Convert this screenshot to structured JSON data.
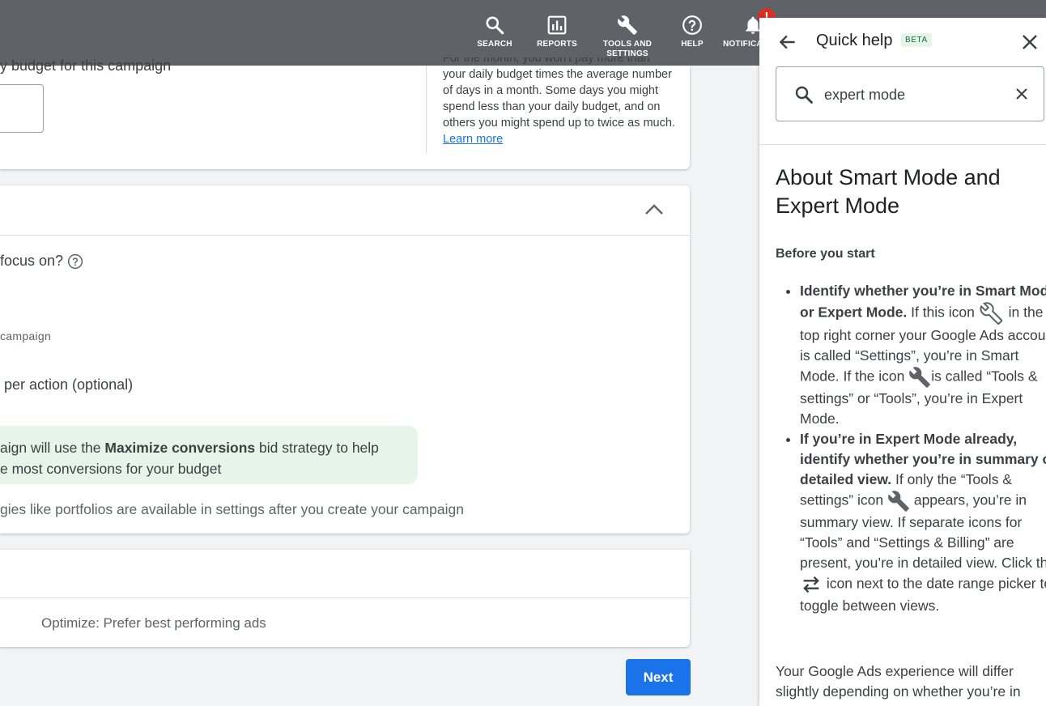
{
  "topbar": {
    "buttons": [
      {
        "label": "SEARCH",
        "icon": "search-icon"
      },
      {
        "label": "REPORTS",
        "icon": "reports-icon"
      },
      {
        "label": "TOOLS AND SETTINGS",
        "label_line1": "TOOLS AND",
        "label_line2": "SETTINGS",
        "icon": "wrench-icon"
      },
      {
        "label": "HELP",
        "icon": "help-icon"
      },
      {
        "label": "NOTIFICA",
        "icon": "bell-icon",
        "badge": "!"
      }
    ]
  },
  "budget": {
    "label": "y budget for this campaign",
    "help_line0": "For the month, you won't pay more than",
    "help_text": "your daily budget times the average number of days in a month. Some days you might spend less than your daily budget, and on others you might spend up to twice as much.",
    "learn_more": "Learn more"
  },
  "bidding": {
    "question": "focus on?",
    "campaign_label": "campaign",
    "cpa_label": "per action (optional)",
    "info_pre": "aign will use the ",
    "info_bold": "Maximize conversions",
    "info_post": " bid strategy to help",
    "info_line2": "e most conversions for your budget",
    "portfolio_text": "gies like portfolios are available in settings after you create your campaign"
  },
  "rotation": {
    "optimize_text": "Optimize: Prefer best performing ads"
  },
  "next_button": "Next",
  "quick_help": {
    "title": "Quick help",
    "beta": "BETA",
    "search_value": "expert mode",
    "article_title": "About Smart Mode and Expert Mode",
    "before_heading": "Before you start",
    "b1_bold": "Identify whether you’re in Smart Mode or Expert Mode.",
    "b1_t1": " If this icon ",
    "b1_t2": " in the top right corner your Google Ads account is called “Settings”, you’re in Smart Mode. If the icon ",
    "b1_t3": "is called “Tools & settings” or “Tools”, you’re in Expert Mode.",
    "b2_bold": "If you’re in Expert Mode already, identify whether you’re in summary or detailed view.",
    "b2_t1": " If only the “Tools & settings” icon ",
    "b2_t2": " appears, you’re in summary view. If separate icons for “Tools” and “Settings & Billing” are present, you’re in detailed view. Click the ",
    "b2_t3": " icon next to the date range picker to toggle between views.",
    "differ_text": "Your Google Ads experience will differ slightly depending on whether you’re in"
  },
  "colors": {
    "topbar": "#5f6368",
    "accent": "#1a73e8",
    "info_bg": "#e6f4ea",
    "badge": "#d93025"
  }
}
